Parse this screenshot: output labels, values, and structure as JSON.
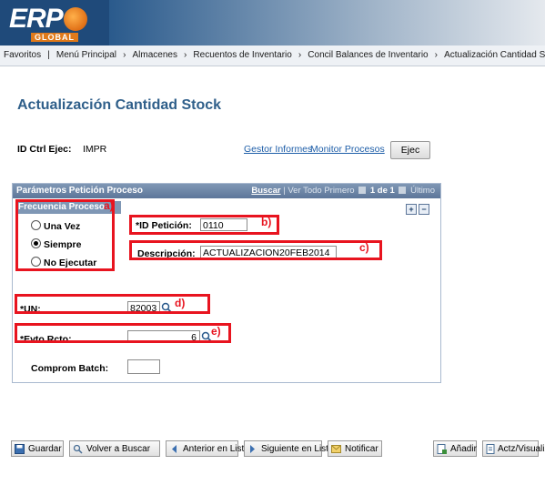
{
  "brand": {
    "name": "ERP",
    "sub": "GLOBAL"
  },
  "nav": {
    "items": [
      "Favoritos",
      "Menú Principal",
      "Almacenes",
      "Recuentos de Inventario",
      "Concil Balances de Inventario",
      "Actualización Cantidad Stock"
    ],
    "separator": "›"
  },
  "page_title": "Actualización Cantidad Stock",
  "run_control": {
    "label": "ID Ctrl Ejec:",
    "value": "IMPR",
    "link_report_manager": "Gestor Informes",
    "link_process_monitor": "Monitor Procesos",
    "run_button": "Ejec"
  },
  "panel": {
    "title": "Parámetros Petición Proceso",
    "tools": {
      "buscar": "Buscar",
      "sep": "|",
      "ver_todo": "Ver Todo",
      "primero": "Primero",
      "count": "1 de 1",
      "ultimo": "Último"
    },
    "plus": "+",
    "minus": "−",
    "frequency": {
      "title": "Frecuencia Proceso",
      "options": [
        "Una Vez",
        "Siempre",
        "No Ejecutar"
      ],
      "selected": "Siempre"
    },
    "request_id": {
      "label": "*ID Petición:",
      "value": "0110"
    },
    "description": {
      "label": "Descripción:",
      "value": "ACTUALIZACION20FEB2014"
    },
    "un": {
      "label": "*UN:",
      "value": "82003"
    },
    "evto": {
      "label": "*Evto Rcto:",
      "value": "6"
    },
    "batch": {
      "label": "Comprom Batch:",
      "value": ""
    }
  },
  "annotations": [
    "a)",
    "b)",
    "c)",
    "d)",
    "e)"
  ],
  "toolbar": {
    "save": "Guardar",
    "back_search": "Volver a Buscar",
    "prev": "Anterior en Lista",
    "next": "Siguiente en Lista",
    "notify": "Notificar",
    "add": "Añadir",
    "update": "Actz/Visualizar"
  },
  "colors": {
    "accent_blue": "#2f5f8a",
    "annotation_red": "#e8141f",
    "panel_header": "#5d7699",
    "brand_orange": "#e07a1b"
  }
}
